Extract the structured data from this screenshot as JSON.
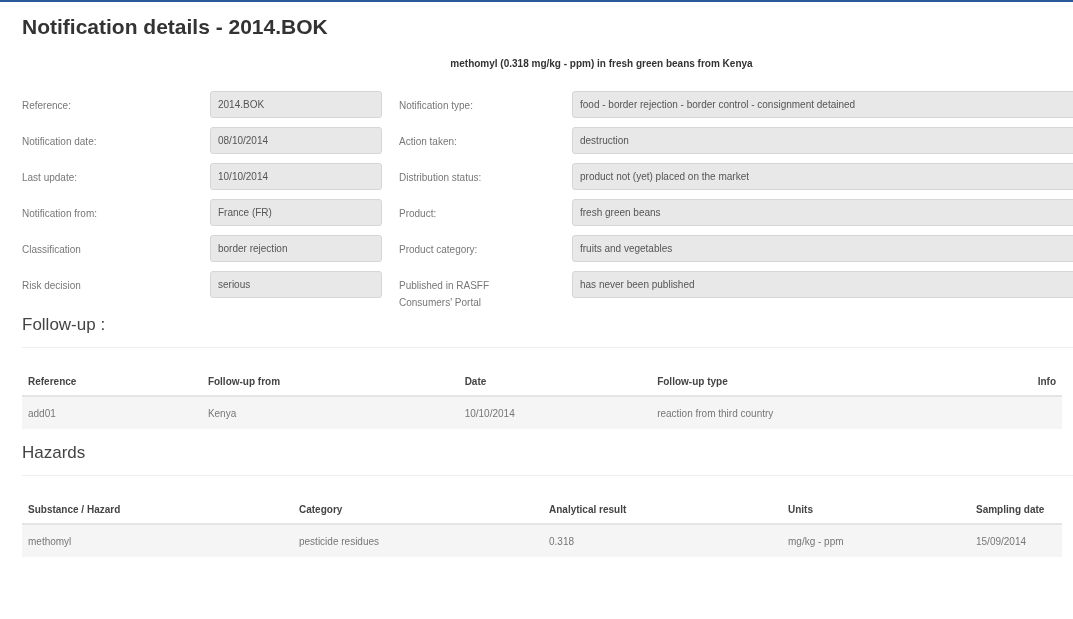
{
  "title": "Notification details - 2014.BOK",
  "subject": "methomyl (0.318 mg/kg - ppm) in fresh green beans from Kenya",
  "details": [
    {
      "left": {
        "label": "Reference:",
        "value": "2014.BOK"
      },
      "right": {
        "label": "Notification type:",
        "value": "food - border rejection - border control - consignment detained"
      }
    },
    {
      "left": {
        "label": "Notification date:",
        "value": "08/10/2014"
      },
      "right": {
        "label": "Action taken:",
        "value": "destruction"
      }
    },
    {
      "left": {
        "label": "Last update:",
        "value": "10/10/2014"
      },
      "right": {
        "label": "Distribution status:",
        "value": "product not (yet) placed on the market"
      }
    },
    {
      "left": {
        "label": "Notification from:",
        "value": "France (FR)"
      },
      "right": {
        "label": "Product:",
        "value": "fresh green beans"
      }
    },
    {
      "left": {
        "label": "Classification",
        "value": "border rejection"
      },
      "right": {
        "label": "Product category:",
        "value": "fruits and vegetables"
      }
    },
    {
      "left": {
        "label": "Risk decision",
        "value": "serious"
      },
      "right": {
        "label": "Published in RASFF Consumers' Portal",
        "value": "has never been published"
      }
    }
  ],
  "follow_up": {
    "heading": "Follow-up :",
    "columns": [
      "Reference",
      "Follow-up from",
      "Date",
      "Follow-up type",
      "Info"
    ],
    "rows": [
      [
        "add01",
        "Kenya",
        "10/10/2014",
        "reaction from third country"
      ]
    ]
  },
  "hazards": {
    "heading": "Hazards",
    "columns": [
      "Substance / Hazard",
      "Category",
      "Analytical result",
      "Units",
      "Sampling date"
    ],
    "rows": [
      [
        "methomyl",
        "pesticide residues",
        "0.318",
        "mg/kg - ppm",
        "15/09/2014"
      ]
    ]
  }
}
